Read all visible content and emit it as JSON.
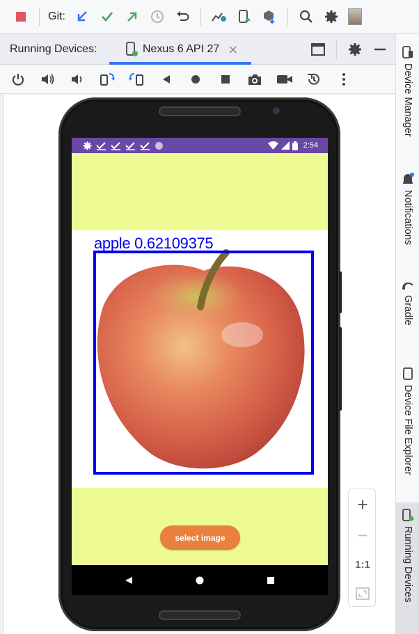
{
  "toolbar": {
    "git_label": "Git:",
    "icons": [
      "stop-icon",
      "git-update-icon",
      "git-commit-icon",
      "git-push-icon",
      "history-icon",
      "rollback-icon",
      "profiler-icon",
      "device-mirror-icon",
      "sdk-manager-icon",
      "search-icon",
      "settings-icon",
      "user-avatar"
    ]
  },
  "tabbar": {
    "section_label": "Running Devices:",
    "device_tab": "Nexus 6 API 27",
    "close_glyph": "×"
  },
  "devbar": {
    "icons": [
      "power-icon",
      "volume-up-icon",
      "volume-down-icon",
      "rotate-left-icon",
      "rotate-right-icon",
      "back-icon",
      "home-icon",
      "overview-icon",
      "screenshot-icon",
      "screenrecord-icon",
      "snapshot-icon",
      "more-icon"
    ]
  },
  "device": {
    "status_time": "2:54",
    "detection_label": "apple 0.62109375",
    "button_label": "select image",
    "colors": {
      "statusbar": "#6a48a5",
      "background": "#eefa93",
      "box": "#0000ee",
      "button": "#e9803d"
    }
  },
  "zoom": {
    "zoom_in": "+",
    "zoom_out": "−",
    "actual_size": "1:1"
  },
  "right_strip": {
    "items": [
      {
        "label": "Device Manager",
        "icon": "device-manager-icon"
      },
      {
        "label": "Notifications",
        "icon": "bell-icon"
      },
      {
        "label": "Gradle",
        "icon": "gradle-icon"
      },
      {
        "label": "Device File Explorer",
        "icon": "device-file-explorer-icon"
      },
      {
        "label": "Running Devices",
        "icon": "running-devices-icon"
      }
    ]
  }
}
